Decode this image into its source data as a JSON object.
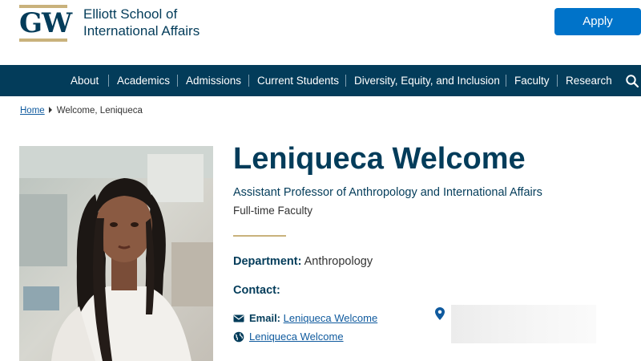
{
  "header": {
    "logo_text": "GW",
    "school_name_line1": "Elliott School of",
    "school_name_line2": "International Affairs",
    "apply_label": "Apply"
  },
  "nav": {
    "items": [
      "About",
      "Academics",
      "Admissions",
      "Current Students",
      "Diversity, Equity, and Inclusion",
      "Faculty",
      "Research"
    ],
    "search_icon": "search-icon"
  },
  "breadcrumb": {
    "home": "Home",
    "current": "Welcome, Leniqueca"
  },
  "profile": {
    "name": "Leniqueca Welcome",
    "title": "Assistant Professor of Anthropology and International Affairs",
    "type": "Full-time Faculty",
    "department_label": "Department:",
    "department_value": "Anthropology",
    "contact_label": "Contact:",
    "email_label": "Email:",
    "email_link": "Leniqueca Welcome",
    "website_link": "Leniqueca Welcome"
  },
  "colors": {
    "navy": "#033c5a",
    "gold": "#c9b27c",
    "apply_blue": "#0073c9",
    "link_blue": "#0f5a9e"
  }
}
